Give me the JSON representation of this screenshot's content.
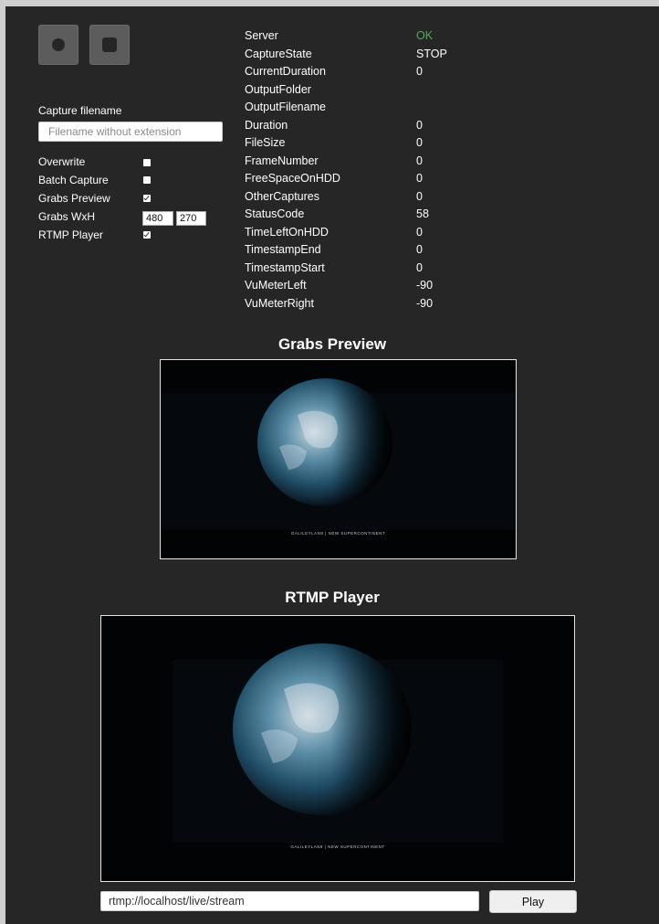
{
  "controls": {
    "record_icon": "record-icon",
    "stop_icon": "stop-icon"
  },
  "capture": {
    "filename_label": "Capture filename",
    "filename_placeholder": "Filename without extension",
    "filename_value": "",
    "options": {
      "overwrite": {
        "label": "Overwrite",
        "checked": false
      },
      "batch_capture": {
        "label": "Batch Capture",
        "checked": false
      },
      "grabs_preview": {
        "label": "Grabs Preview",
        "checked": true
      },
      "grabs_wxh": {
        "label": "Grabs WxH",
        "width": "480",
        "height": "270"
      },
      "rtmp_player": {
        "label": "RTMP Player",
        "checked": true
      }
    }
  },
  "status": {
    "rows": [
      {
        "key": "Server",
        "value": "OK"
      },
      {
        "key": "CaptureState",
        "value": "STOP"
      },
      {
        "key": "CurrentDuration",
        "value": "0"
      },
      {
        "key": "OutputFolder",
        "value": ""
      },
      {
        "key": "OutputFilename",
        "value": ""
      },
      {
        "key": "Duration",
        "value": "0"
      },
      {
        "key": "FileSize",
        "value": "0"
      },
      {
        "key": "FrameNumber",
        "value": "0"
      },
      {
        "key": "FreeSpaceOnHDD",
        "value": "0"
      },
      {
        "key": "OtherCaptures",
        "value": "0"
      },
      {
        "key": "StatusCode",
        "value": "58"
      },
      {
        "key": "TimeLeftOnHDD",
        "value": "0"
      },
      {
        "key": "TimestampEnd",
        "value": "0"
      },
      {
        "key": "TimestampStart",
        "value": "0"
      },
      {
        "key": "VuMeterLeft",
        "value": "-90"
      },
      {
        "key": "VuMeterRight",
        "value": "-90"
      }
    ],
    "ok_color": "#4caf50"
  },
  "grabs_preview": {
    "title": "Grabs Preview",
    "caption": "GALILEYLAN8  |  NEW SUPERCONTINENT"
  },
  "rtmp_player": {
    "title": "RTMP Player",
    "caption": "GALILEYLAN8  |  NEW SUPERCONTINENT",
    "url_value": "rtmp://localhost/live/stream",
    "play_label": "Play"
  }
}
